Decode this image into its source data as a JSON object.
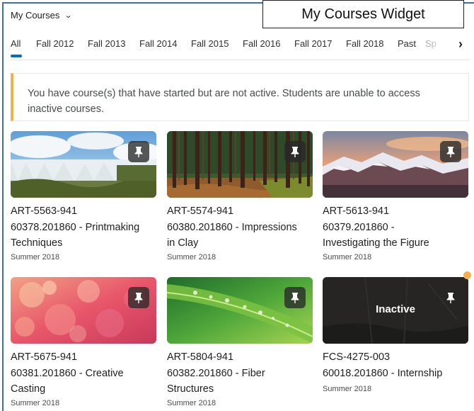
{
  "header": {
    "title": "My Courses",
    "dropdown_icon": "chevron-down-icon"
  },
  "callout": {
    "label": "My Courses Widget"
  },
  "tabs": [
    {
      "label": "All",
      "active": true
    },
    {
      "label": "Fall 2012"
    },
    {
      "label": "Fall 2013"
    },
    {
      "label": "Fall 2014"
    },
    {
      "label": "Fall 2015"
    },
    {
      "label": "Fall 2016"
    },
    {
      "label": "Fall 2017"
    },
    {
      "label": "Fall 2018"
    },
    {
      "label": "Past"
    },
    {
      "label": "Sp"
    }
  ],
  "alert": {
    "message": "You have course(s) that have started but are not active. Students are unable to access inactive courses.",
    "accent_color": "#f6b04b"
  },
  "courses": [
    {
      "code": "ART-5563-941",
      "name_line1": "60378.201860 - Printmaking",
      "name_line2": "Techniques",
      "term": "Summer 2018",
      "image": "waterfall",
      "pin_icon": "pin-icon"
    },
    {
      "code": "ART-5574-941",
      "name_line1": "60380.201860 - Impressions",
      "name_line2": "in Clay",
      "term": "Summer 2018",
      "image": "forest",
      "pin_icon": "pin-icon"
    },
    {
      "code": "ART-5613-941",
      "name_line1": "60379.201860 -",
      "name_line2": "Investigating the Figure",
      "term": "Summer 2018",
      "image": "mountains",
      "pin_icon": "pin-icon"
    },
    {
      "code": "ART-5675-941",
      "name_line1": "60381.201860 - Creative",
      "name_line2": "Casting",
      "term": "Summer 2018",
      "image": "bokeh",
      "pin_icon": "pin-icon"
    },
    {
      "code": "ART-5804-941",
      "name_line1": "60382.201860 - Fiber",
      "name_line2": "Structures",
      "term": "Summer 2018",
      "image": "leaf",
      "pin_icon": "pin-icon"
    },
    {
      "code": "FCS-4275-003",
      "name_line1": "60018.201860 - Internship",
      "name_line2": "",
      "term": "Summer 2018",
      "image": "inactive-dark",
      "status": "Inactive",
      "pin_icon": "pin-icon"
    }
  ]
}
